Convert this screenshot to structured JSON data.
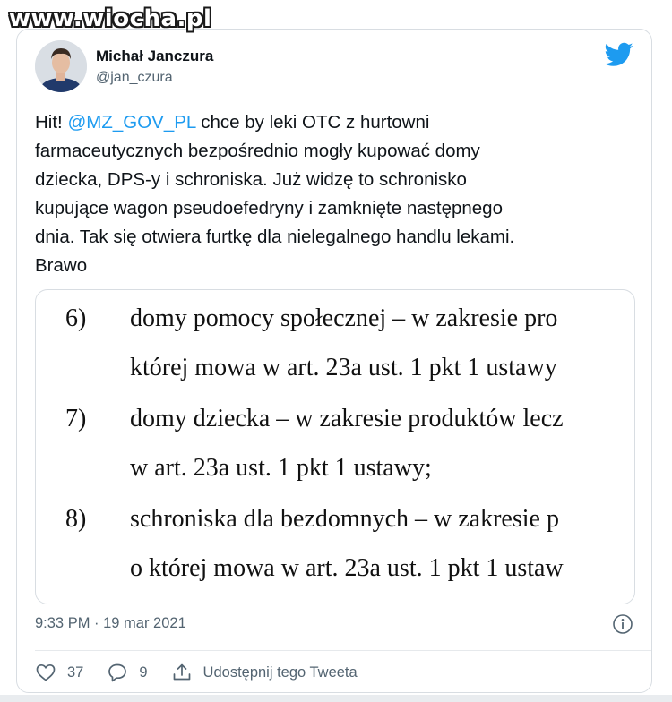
{
  "watermark": "www.wiocha.pl",
  "tweet": {
    "author_name": "Michał Janczura",
    "author_handle": "@jan_czura",
    "text_before_mention": "Hit! ",
    "mention": "@MZ_GOV_PL",
    "text_after_mention": " chce by leki OTC z hurtowni\nfarmaceutycznych bezpośrednio mogły kupować domy\ndziecka, DPS-y i schroniska. Już widzę to schronisko\nkupujące wagon pseudoefedryny i zamknięte następnego\ndnia. Tak się otwiera furtkę dla nielegalnego handlu lekami.\nBrawo",
    "timestamp": "9:33 PM · 19 mar 2021",
    "likes_count": "37",
    "replies_count": "9",
    "share_label": "Udostępnij tego Tweeta"
  },
  "document": {
    "items": [
      {
        "number": "6)",
        "line1": "domy pomocy społecznej  – w zakresie pro",
        "line2": "której mowa w art. 23a ust. 1 pkt 1 ustawy"
      },
      {
        "number": "7)",
        "line1": "domy dziecka – w zakresie produktów lecz",
        "line2": "w art. 23a ust. 1 pkt 1 ustawy;"
      },
      {
        "number": "8)",
        "line1": "schroniska dla bezdomnych – w zakresie p",
        "line2": "o której mowa w art. 23a ust. 1 pkt 1 ustaw"
      }
    ]
  },
  "colors": {
    "accent": "#1d9bf0",
    "text": "#0f1419",
    "secondary": "#536471"
  },
  "icons": {
    "brand": "twitter-bird-icon",
    "like": "heart-icon",
    "reply": "speech-bubble-icon",
    "share": "share-arrow-icon",
    "info": "info-icon"
  }
}
